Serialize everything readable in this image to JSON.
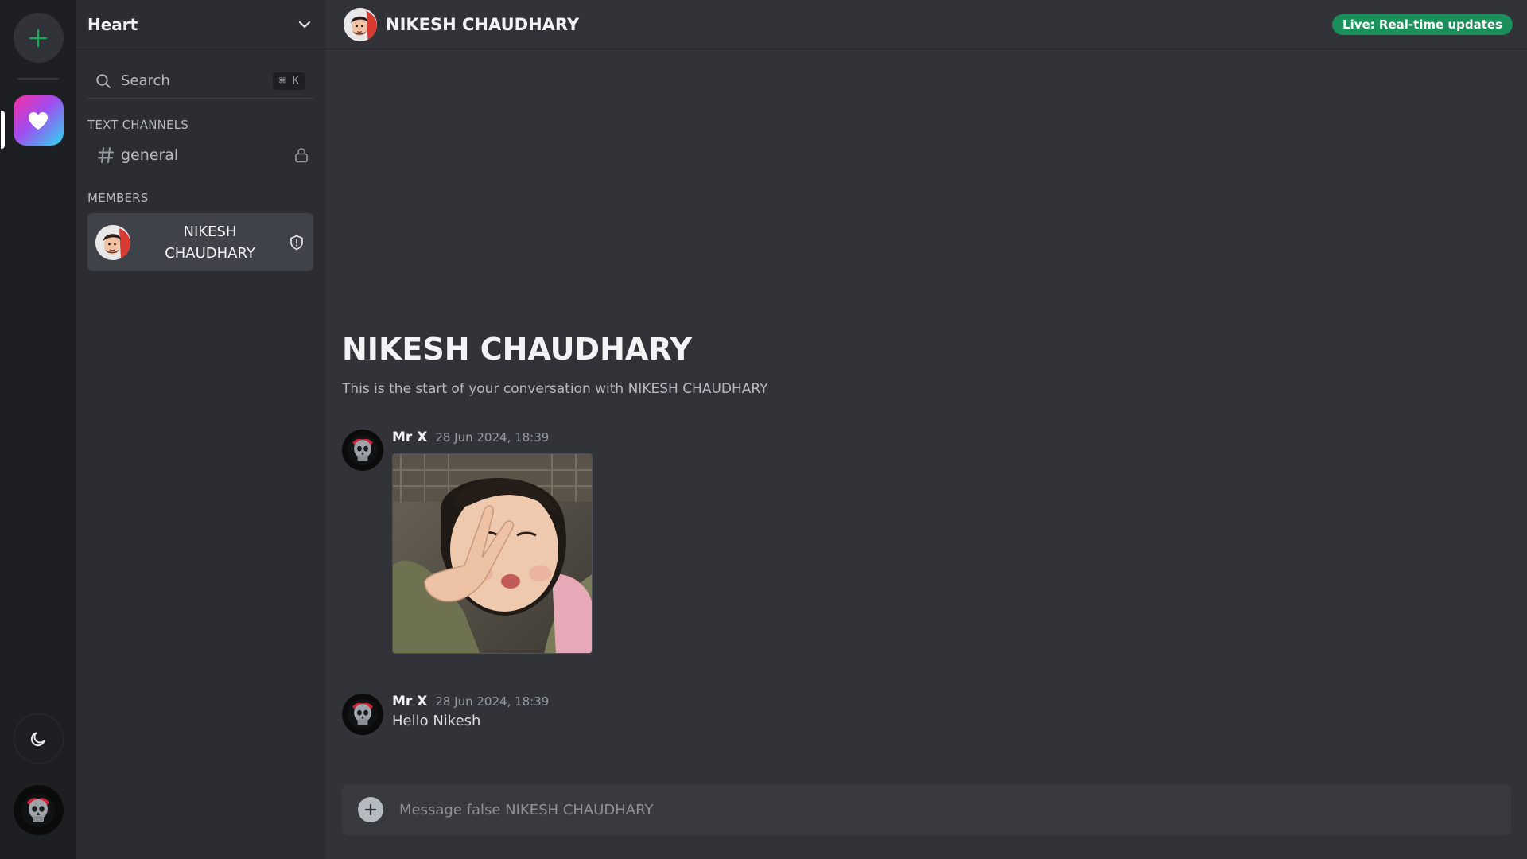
{
  "colors": {
    "accent_green": "#1a8f5a",
    "plus_green": "#23a55a",
    "rail_bg": "#1e1f22",
    "sidebar_bg": "#2b2d31",
    "main_bg": "#313338"
  },
  "rail": {
    "add_server_icon": "plus-icon",
    "active_server_icon": "heart-icon",
    "theme_toggle_icon": "moon-icon",
    "user_avatar_icon": "skull-avatar"
  },
  "server": {
    "name": "Heart",
    "menu_icon": "chevron-down-icon"
  },
  "search": {
    "label": "Search",
    "shortcut_symbol": "⌘",
    "shortcut_key": "K"
  },
  "sections": {
    "text_channels": "TEXT CHANNELS",
    "members": "MEMBERS"
  },
  "channels": [
    {
      "name": "general",
      "icon": "hash-icon",
      "lock_icon": "lock-icon"
    }
  ],
  "members": [
    {
      "name": "NIKESH CHAUDHARY",
      "role_icon": "shield-icon"
    }
  ],
  "header": {
    "title": "NIKESH CHAUDHARY",
    "live_badge": "Live: Real-time updates"
  },
  "welcome": {
    "title": "NIKESH CHAUDHARY",
    "subtitle": "This is the start of your conversation with NIKESH CHAUDHARY"
  },
  "messages": [
    {
      "author": "Mr X",
      "timestamp": "28 Jun 2024, 18:39",
      "attachment": "image"
    },
    {
      "author": "Mr X",
      "timestamp": "28 Jun 2024, 18:39",
      "text": "Hello Nikesh"
    }
  ],
  "composer": {
    "placeholder": "Message false NIKESH CHAUDHARY"
  }
}
